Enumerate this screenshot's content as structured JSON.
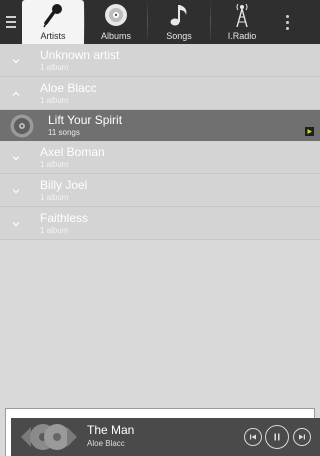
{
  "colors": {
    "topbar": "#2f2f2f",
    "active_tab": "#f4f4f4",
    "list_background": "#d9d9d9",
    "selected_album_row": "#707070",
    "player_bar": "#4a4a4a",
    "play_badge_accent": "#c6e000"
  },
  "topbar": {
    "menu_icon": "hamburger-menu-icon",
    "overflow_icon": "overflow-menu-icon",
    "tabs": [
      {
        "label": "Artists",
        "icon": "microphone-icon",
        "active": true
      },
      {
        "label": "Albums",
        "icon": "disc-icon",
        "active": false
      },
      {
        "label": "Songs",
        "icon": "music-note-icon",
        "active": false
      },
      {
        "label": "I.Radio",
        "icon": "radio-tower-icon",
        "active": false
      }
    ]
  },
  "list": {
    "artists": [
      {
        "name": "Unknown artist",
        "sub": "1 album",
        "expanded": false
      },
      {
        "name": "Aloe Blacc",
        "sub": "1 album",
        "expanded": true,
        "albums": [
          {
            "name": "Lift Your Spirit",
            "sub": "11 songs",
            "playing": true
          }
        ]
      },
      {
        "name": "Axel Boman",
        "sub": "1 album",
        "expanded": false
      },
      {
        "name": "Billy Joel",
        "sub": "1 album",
        "expanded": false
      },
      {
        "name": "Faithless",
        "sub": "1 album",
        "expanded": false
      }
    ]
  },
  "player": {
    "title": "The Man",
    "artist": "Aloe Blacc",
    "controls": [
      "previous-icon",
      "pause-icon",
      "next-icon"
    ]
  }
}
